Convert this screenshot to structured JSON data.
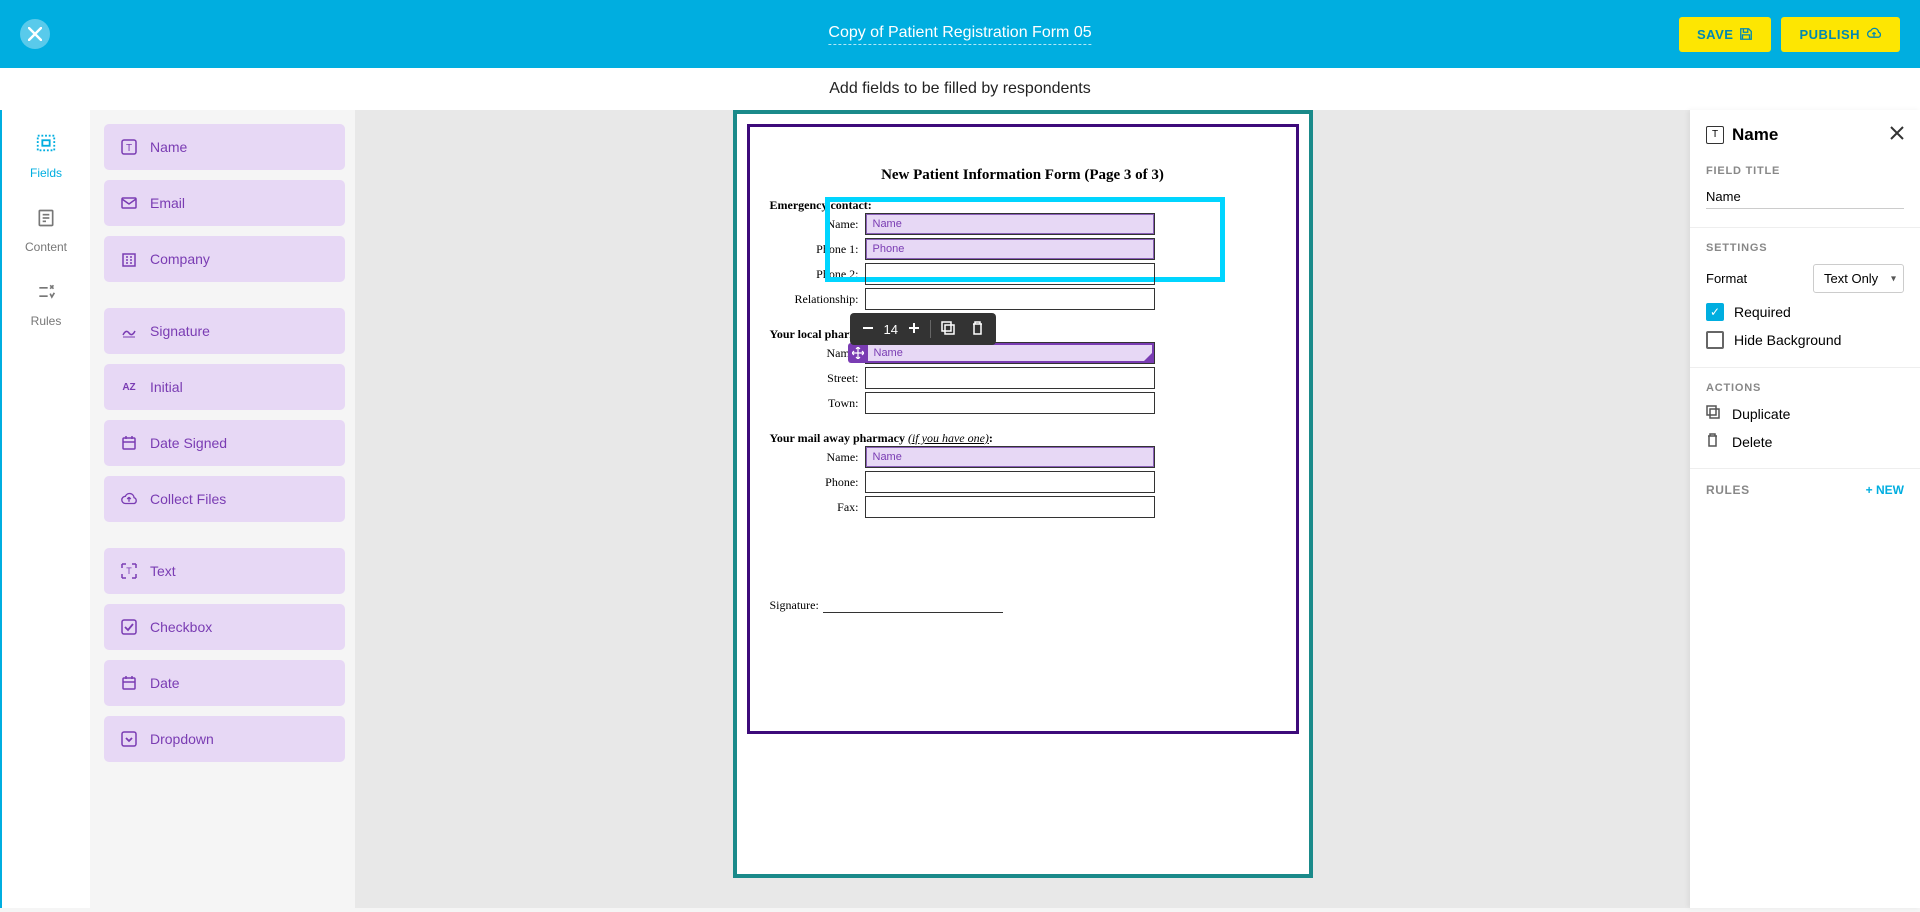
{
  "topbar": {
    "title": "Copy of Patient Registration Form 05",
    "save_label": "SAVE",
    "publish_label": "PUBLISH"
  },
  "subheader": {
    "text": "Add fields to be filled by respondents"
  },
  "leftnav": {
    "fields": "Fields",
    "content": "Content",
    "rules": "Rules"
  },
  "field_types": {
    "name": "Name",
    "email": "Email",
    "company": "Company",
    "signature": "Signature",
    "initial": "Initial",
    "date_signed": "Date Signed",
    "collect_files": "Collect Files",
    "text": "Text",
    "checkbox": "Checkbox",
    "date": "Date",
    "dropdown": "Dropdown"
  },
  "document": {
    "title": "New Patient Information Form (Page 3 of 3)",
    "sections": {
      "emergency": {
        "label": "Emergency contact:",
        "name": "Name:",
        "phone1": "Phone 1:",
        "phone2": "Phone 2:",
        "relationship": "Relationship:"
      },
      "pharmacy": {
        "label": "Your local pharmacy:",
        "name": "Name:",
        "street": "Street:",
        "town": "Town:"
      },
      "mail": {
        "label_a": "Your mail away pharmacy ",
        "label_b": "(if you have one)",
        "label_c": ":",
        "name": "Name:",
        "phone": "Phone:",
        "fax": "Fax:"
      }
    },
    "signature_label": "Signature:",
    "placed": {
      "name": "Name",
      "phone": "Phone"
    }
  },
  "field_toolbar": {
    "font_size": "14"
  },
  "right_panel": {
    "title": "Name",
    "field_title_label": "FIELD TITLE",
    "field_title_value": "Name",
    "settings_label": "SETTINGS",
    "format_label": "Format",
    "format_value": "Text Only",
    "required_label": "Required",
    "hide_bg_label": "Hide Background",
    "actions_label": "ACTIONS",
    "duplicate_label": "Duplicate",
    "delete_label": "Delete",
    "rules_label": "RULES",
    "new_rule": "+ NEW"
  }
}
